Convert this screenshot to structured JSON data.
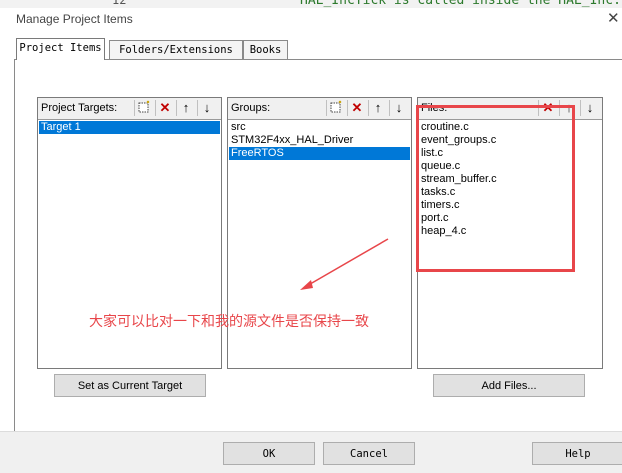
{
  "window": {
    "title": "Manage Project Items",
    "close_glyph": "✕"
  },
  "background": {
    "line_number": "12",
    "code_text": "HAL_IncTick is called inside the HAL_Inc..."
  },
  "tabs": [
    {
      "label": "Project Items",
      "active": true
    },
    {
      "label": "Folders/Extensions",
      "active": false
    },
    {
      "label": "Books",
      "active": false
    }
  ],
  "targets": {
    "label": "Project Targets:",
    "items": [
      {
        "name": "Target 1",
        "selected": true
      }
    ],
    "button": "Set as Current Target"
  },
  "groups": {
    "label": "Groups:",
    "items": [
      {
        "name": "src",
        "selected": false
      },
      {
        "name": "STM32F4xx_HAL_Driver",
        "selected": false
      },
      {
        "name": "FreeRTOS",
        "selected": true
      }
    ]
  },
  "files": {
    "label": "Files:",
    "items": [
      "croutine.c",
      "event_groups.c",
      "list.c",
      "queue.c",
      "stream_buffer.c",
      "tasks.c",
      "timers.c",
      "port.c",
      "heap_4.c"
    ],
    "button": "Add Files..."
  },
  "toolbar_icons": {
    "new": "new-icon",
    "delete": "delete-icon",
    "up": "up-arrow-icon",
    "down": "down-arrow-icon"
  },
  "annotation": {
    "text": "大家可以比对一下和我的源文件是否保持一致",
    "color": "#e8464a"
  },
  "footer": {
    "ok": "OK",
    "cancel": "Cancel",
    "help": "Help"
  },
  "colors": {
    "selection": "#0078d7",
    "annotation": "#e8464a"
  }
}
